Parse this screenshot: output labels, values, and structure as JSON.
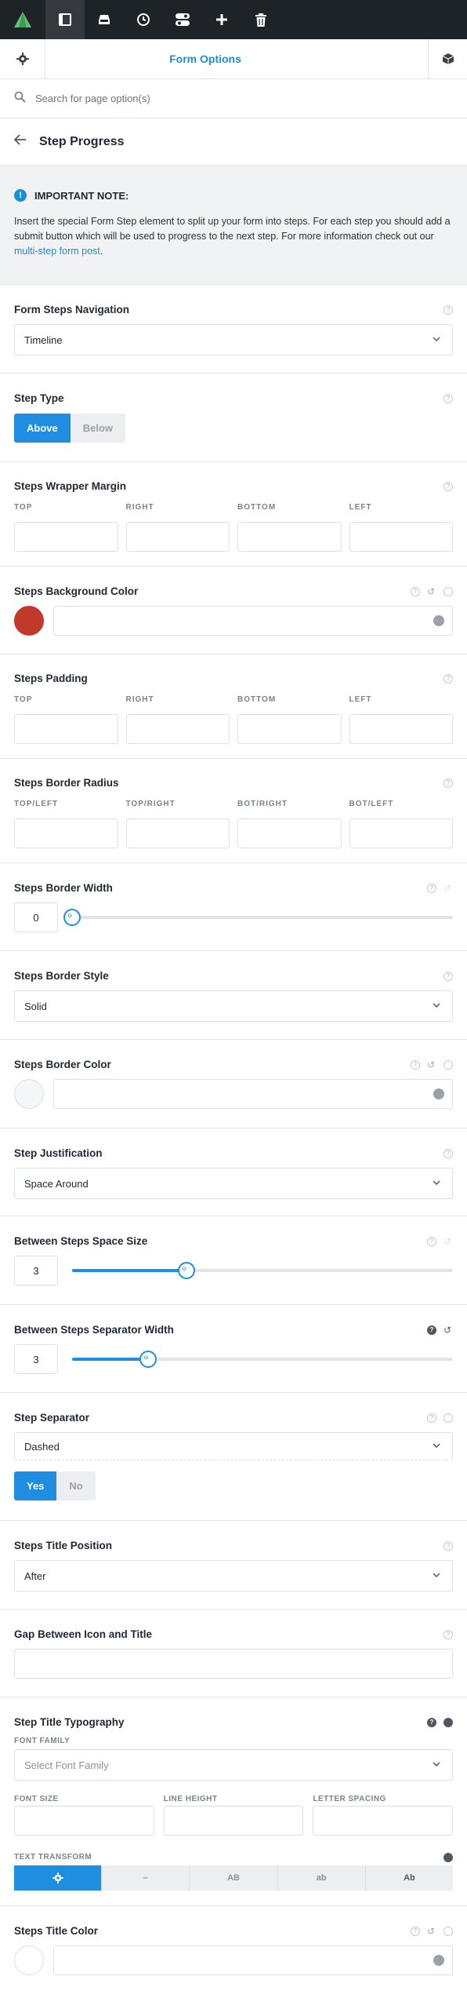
{
  "toolbar": {
    "logo": "avada-logo-icon",
    "buttons": [
      "sidebar-icon",
      "layers-icon",
      "history-icon",
      "toggle-icon",
      "plus-icon",
      "trash-icon"
    ]
  },
  "tabs": {
    "title": "Form Options"
  },
  "search": {
    "placeholder": "Search for page option(s)"
  },
  "header": {
    "title": "Step Progress"
  },
  "note": {
    "title": "IMPORTANT NOTE:",
    "text": "Insert the special Form Step element to split up your form into steps. For each step you should add a submit button which will be used to progress to the next step. For more information check out our ",
    "link": "multi-step form post",
    "end": "."
  },
  "options": {
    "nav": {
      "label": "Form Steps Navigation",
      "value": "Timeline"
    },
    "type": {
      "label": "Step Type",
      "buttons": [
        "Above",
        "Below"
      ],
      "selected": "Above"
    },
    "wrapper_margin": {
      "label": "Steps Wrapper Margin",
      "fields": [
        "TOP",
        "RIGHT",
        "BOTTOM",
        "LEFT"
      ]
    },
    "bg_color": {
      "label": "Steps Background Color",
      "color": "#c0392b"
    },
    "padding": {
      "label": "Steps Padding",
      "fields": [
        "TOP",
        "RIGHT",
        "BOTTOM",
        "LEFT"
      ]
    },
    "radius": {
      "label": "Steps Border Radius",
      "fields": [
        "TOP/LEFT",
        "TOP/RIGHT",
        "BOT/RIGHT",
        "BOT/LEFT"
      ]
    },
    "border_width": {
      "label": "Steps Border Width",
      "value": "0",
      "fraction": 0.0
    },
    "border_style": {
      "label": "Steps Border Style",
      "value": "Solid"
    },
    "border_color": {
      "label": "Steps Border Color"
    },
    "justification": {
      "label": "Step Justification",
      "value": "Space Around"
    },
    "space_size": {
      "label": "Between Steps Space Size",
      "value": "3",
      "fraction": 0.3
    },
    "separator_width": {
      "label": "Between Steps Separator Width",
      "value": "3",
      "fraction": 0.2
    },
    "separator": {
      "label": "Step Separator",
      "value": "Dashed",
      "buttons": [
        "Yes",
        "No"
      ],
      "selected": "Yes"
    },
    "title_position": {
      "label": "Steps Title Position",
      "value": "After"
    },
    "gap": {
      "label": "Gap Between Icon and Title"
    },
    "typography": {
      "label": "Step Title Typography",
      "font_family_label": "FONT FAMILY",
      "font_family_placeholder": "Select Font Family",
      "font_size_label": "FONT SIZE",
      "line_height_label": "LINE HEIGHT",
      "letter_spacing_label": "LETTER SPACING",
      "text_transform_label": "TEXT TRANSFORM",
      "transform_buttons": [
        "–",
        "AB",
        "ab",
        "Ab"
      ]
    },
    "title_color": {
      "label": "Steps Title Color"
    }
  }
}
